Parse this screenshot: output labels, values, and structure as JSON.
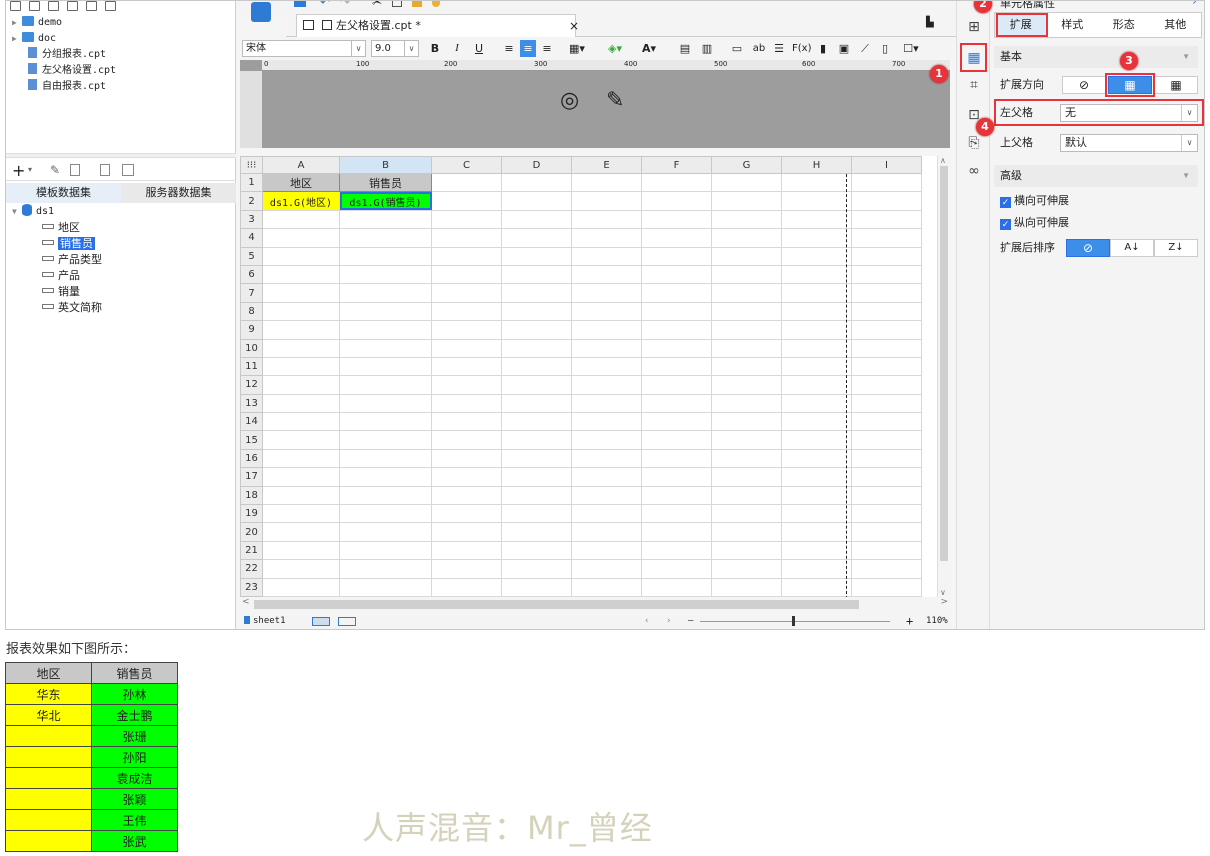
{
  "left_panel": {
    "tree": [
      {
        "label": "demo",
        "type": "folder"
      },
      {
        "label": "doc",
        "type": "folder"
      },
      {
        "label": "分组报表.cpt",
        "type": "file"
      },
      {
        "label": "左父格设置.cpt",
        "type": "file"
      },
      {
        "label": "自由报表.cpt",
        "type": "file"
      }
    ],
    "dataset_tabs": [
      "模板数据集",
      "服务器数据集"
    ],
    "dataset": "ds1",
    "fields": [
      "地区",
      "销售员",
      "产品类型",
      "产品",
      "销量",
      "英文简称"
    ],
    "selected_field": "销售员"
  },
  "editor": {
    "tab_title": "左父格设置.cpt *",
    "close_label": "×",
    "font_name": "宋体",
    "font_size": "9.0",
    "ruler_ticks": [
      "0",
      "100",
      "200",
      "300",
      "400",
      "500",
      "600",
      "700"
    ],
    "columns": [
      "A",
      "B",
      "C",
      "D",
      "E",
      "F",
      "G",
      "H",
      "I"
    ],
    "rows": [
      "1",
      "2",
      "3",
      "4",
      "5",
      "6",
      "7",
      "8",
      "9",
      "10",
      "11",
      "12",
      "13",
      "14",
      "15",
      "16",
      "17",
      "18",
      "19",
      "20",
      "21",
      "22",
      "23"
    ],
    "cell_a1": "地区",
    "cell_b1": "销售员",
    "cell_a2": "ds1.G(地区)",
    "cell_b2": "ds1.G(销售员)",
    "sheet_name": "sheet1",
    "zoom": "110%"
  },
  "right_panel": {
    "title": "单元格属性",
    "tabs": [
      "扩展",
      "样式",
      "形态",
      "其他"
    ],
    "basic_section": "基本",
    "expand_direction_label": "扩展方向",
    "left_parent_label": "左父格",
    "left_parent_value": "无",
    "top_parent_label": "上父格",
    "top_parent_value": "默认",
    "advanced_section": "高级",
    "h_expandable": "横向可伸展",
    "v_expandable": "纵向可伸展",
    "sort_label": "扩展后排序"
  },
  "badges": [
    "1",
    "2",
    "3",
    "4"
  ],
  "result": {
    "caption": "报表效果如下图所示：",
    "headers": [
      "地区",
      "销售员"
    ],
    "rows": [
      [
        "华东",
        "孙林"
      ],
      [
        "华北",
        "金士鹏"
      ],
      [
        "",
        "张珊"
      ],
      [
        "",
        "孙阳"
      ],
      [
        "",
        "袁成洁"
      ],
      [
        "",
        "张颖"
      ],
      [
        "",
        "王伟"
      ],
      [
        "",
        "张武"
      ]
    ]
  },
  "watermark": "人声混音：Mr_曾经",
  "colors": {
    "yellow": "#ffff00",
    "green": "#00ff00",
    "accent": "#2a6ee8",
    "red": "#e8333a"
  }
}
